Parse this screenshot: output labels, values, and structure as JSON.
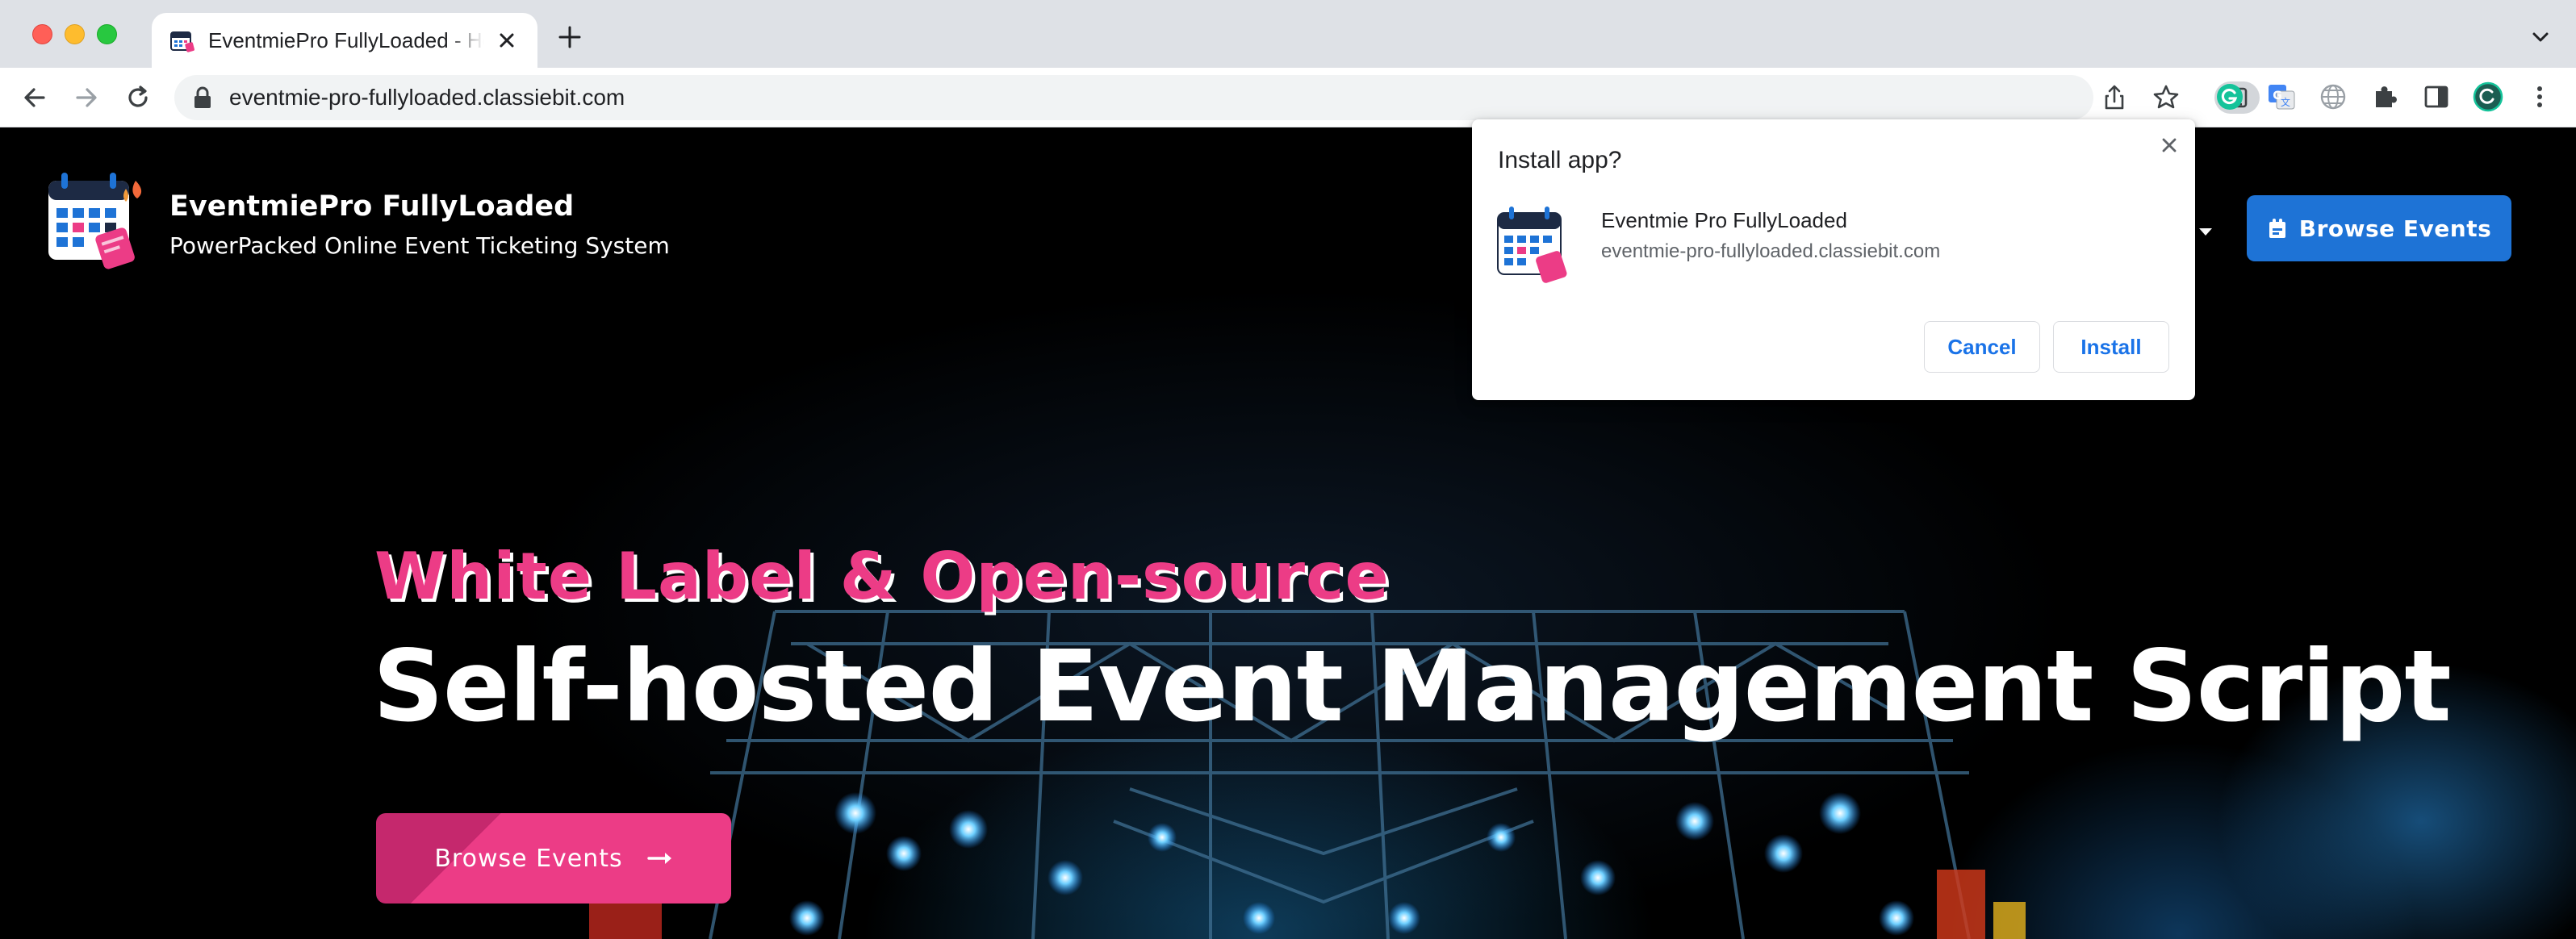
{
  "browser": {
    "tab": {
      "title": "EventmiePro FullyLoaded - Home"
    },
    "url": "eventmie-pro-fullyloaded.classiebit.com"
  },
  "icons": {
    "tab_favicon": "calendar-ticket-icon",
    "tab_close": "close-icon",
    "new_tab": "plus-icon",
    "tabs_menu": "chevron-down-icon",
    "back": "arrow-left-icon",
    "forward": "arrow-right-icon",
    "reload": "reload-icon",
    "lock": "lock-icon",
    "install_app": "install-app-icon",
    "share": "share-icon",
    "bookmark": "star-icon",
    "extensions": [
      "grammarly-icon",
      "google-translate-icon",
      "globe-icon",
      "puzzle-icon",
      "side-panel-icon",
      "profile-avatar-icon",
      "kebab-menu-icon"
    ],
    "ticket_button": "ticket-icon",
    "cta_arrow": "long-arrow-right-icon"
  },
  "site": {
    "brand_name": "EventmiePro FullyLoaded",
    "tagline": "PowerPacked Online Event Ticketing System",
    "header_button": "Browse Events",
    "hero_kicker": "White Label & Open-source",
    "hero_title": "Self-hosted Event Management Script",
    "hero_button": "Browse Events"
  },
  "install_dialog": {
    "title": "Install app?",
    "app_name": "Eventmie Pro FullyLoaded",
    "app_url": "eventmie-pro-fullyloaded.classiebit.com",
    "cancel_label": "Cancel",
    "install_label": "Install"
  },
  "colors": {
    "accent_pink": "#ec3c86",
    "accent_blue": "#1e73d6",
    "chrome_link_blue": "#1a73e8"
  }
}
